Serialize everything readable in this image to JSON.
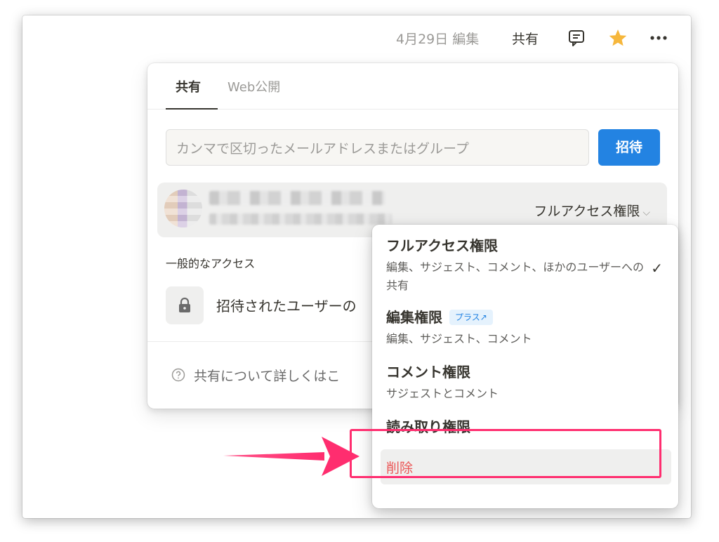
{
  "topbar": {
    "edited": "4月29日 編集",
    "share": "共有"
  },
  "share_panel": {
    "tabs": [
      "共有",
      "Web公開"
    ],
    "invite_placeholder": "カンマで区切ったメールアドレスまたはグループ",
    "invite_button": "招待",
    "member_access": "フルアクセス権限",
    "general_access_label": "一般的なアクセス",
    "general_access_value": "招待されたユーザーの",
    "help_text": "共有について詳しくはこ"
  },
  "permission_menu": {
    "items": [
      {
        "title": "フルアクセス権限",
        "desc": "編集、サジェスト、コメント、ほかのユーザーへの共有",
        "selected": true
      },
      {
        "title": "編集権限",
        "badge": "プラス↗",
        "desc": "編集、サジェスト、コメント"
      },
      {
        "title": "コメント権限",
        "desc": "サジェストとコメント"
      },
      {
        "title": "読み取り権限"
      }
    ],
    "check_mark": "✓",
    "delete": "削除"
  },
  "colors": {
    "accent": "#2383e2",
    "delete_red": "#eb5757",
    "annotation_pink": "#ff2d6f",
    "star": "#f6b73c"
  }
}
